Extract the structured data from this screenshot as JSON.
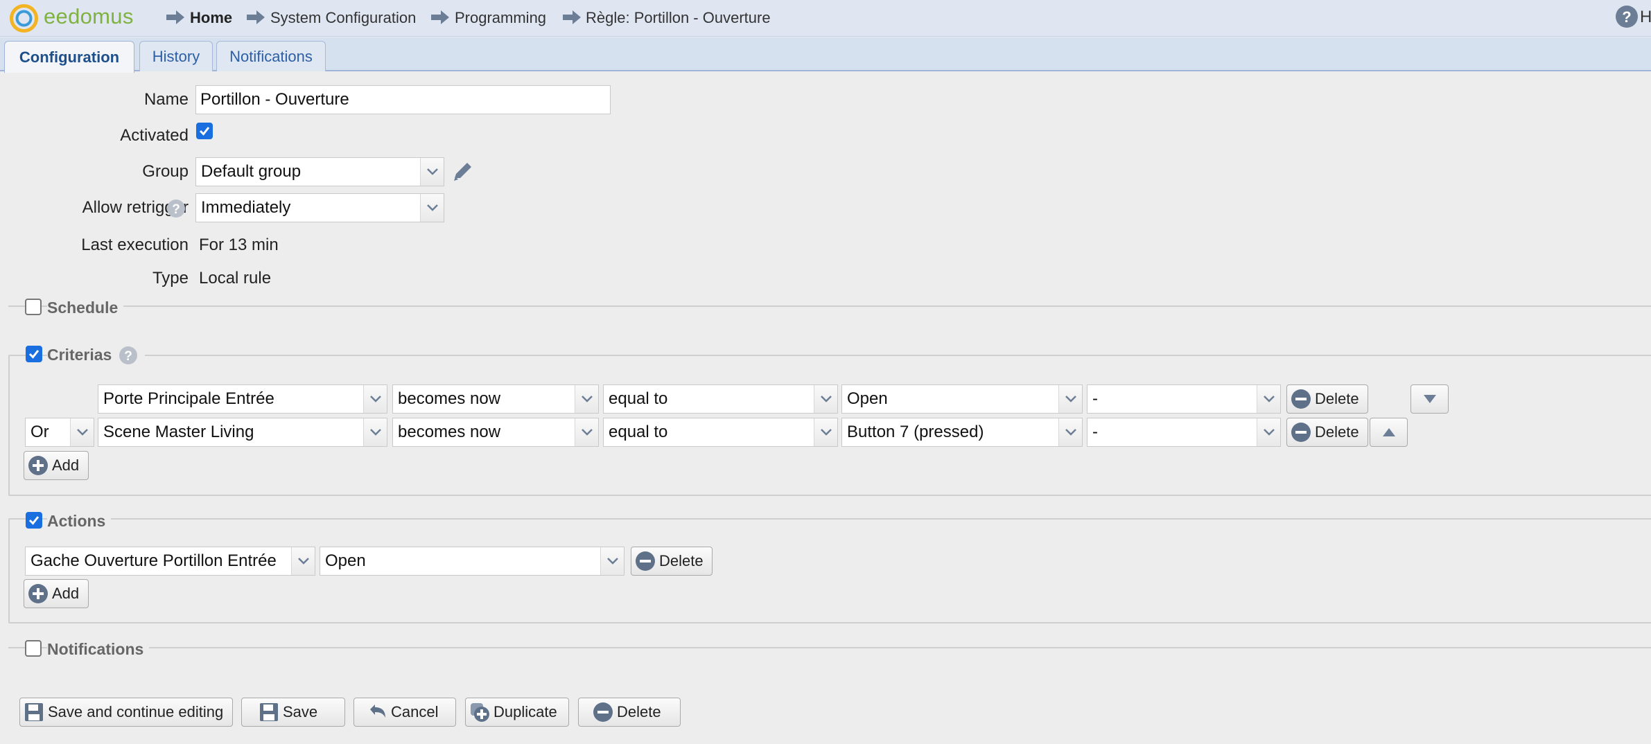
{
  "app": {
    "logo_text": "eedomus",
    "breadcrumb": [
      "Home",
      "System Configuration",
      "Programming",
      "Règle: Portillon - Ouverture"
    ],
    "help_text": "H"
  },
  "tabs": [
    {
      "label": "Configuration",
      "active": true
    },
    {
      "label": "History",
      "active": false
    },
    {
      "label": "Notifications",
      "active": false
    }
  ],
  "form": {
    "name_label": "Name",
    "name_value": "Portillon - Ouverture",
    "activated_label": "Activated",
    "activated": true,
    "group_label": "Group",
    "group_value": "Default group",
    "retrigger_label": "Allow retrigger",
    "retrigger_value": "Immediately",
    "last_exec_label": "Last execution",
    "last_exec_value": "For 13 min",
    "type_label": "Type",
    "type_value": "Local rule"
  },
  "schedule": {
    "label": "Schedule",
    "checked": false
  },
  "criterias": {
    "label": "Criterias",
    "checked": true,
    "rows": [
      {
        "connector": "",
        "device": "Porte Principale Entrée",
        "trigger": "becomes now",
        "operator": "equal to",
        "value": "Open",
        "extra": "-",
        "delete_label": "Delete"
      },
      {
        "connector": "Or",
        "device": "Scene Master Living",
        "trigger": "becomes now",
        "operator": "equal to",
        "value": "Button 7 (pressed)",
        "extra": "-",
        "delete_label": "Delete"
      }
    ],
    "add_label": "Add"
  },
  "actions": {
    "label": "Actions",
    "checked": true,
    "rows": [
      {
        "device": "Gache Ouverture Portillon Entrée",
        "value": "Open",
        "delete_label": "Delete"
      }
    ],
    "add_label": "Add"
  },
  "notifications": {
    "label": "Notifications",
    "checked": false
  },
  "footer": {
    "save_continue": "Save and continue editing",
    "save": "Save",
    "cancel": "Cancel",
    "duplicate": "Duplicate",
    "delete": "Delete"
  },
  "colors": {
    "accent": "#1a6fe0",
    "logo_green": "#7fb240",
    "tab_text": "#2d5fa5",
    "header_bg": "#dfe6f2"
  }
}
